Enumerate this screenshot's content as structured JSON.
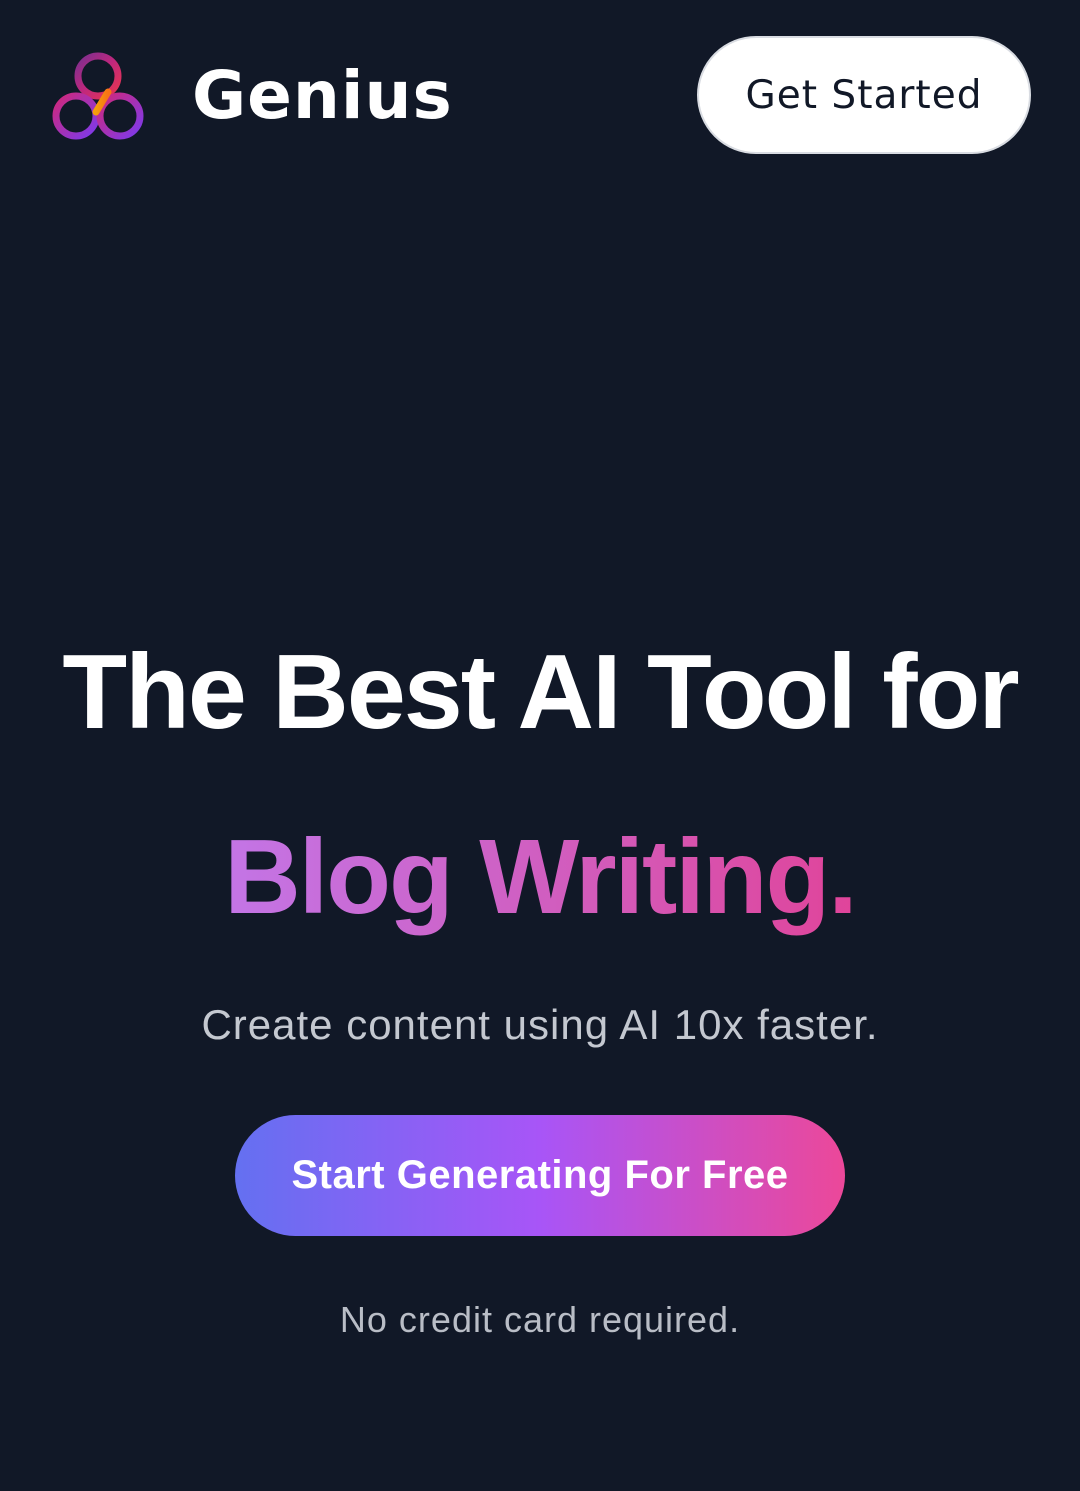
{
  "header": {
    "brand_name": "Genius",
    "logo_icon": "genius-trefoil-logo-icon",
    "get_started_label": "Get Started"
  },
  "hero": {
    "headline_line1": "The Best AI Tool for",
    "headline_line2": "Blog Writing.",
    "subtitle": "Create content using AI 10x faster.",
    "cta_label": "Start Generating For Free",
    "note": "No credit card required."
  },
  "colors": {
    "background": "#111827",
    "gradient_start": "#6470f1",
    "gradient_mid": "#a855f7",
    "gradient_end": "#ec4899",
    "headline_accent_start": "#c375e6",
    "headline_accent_end": "#e0449a"
  }
}
